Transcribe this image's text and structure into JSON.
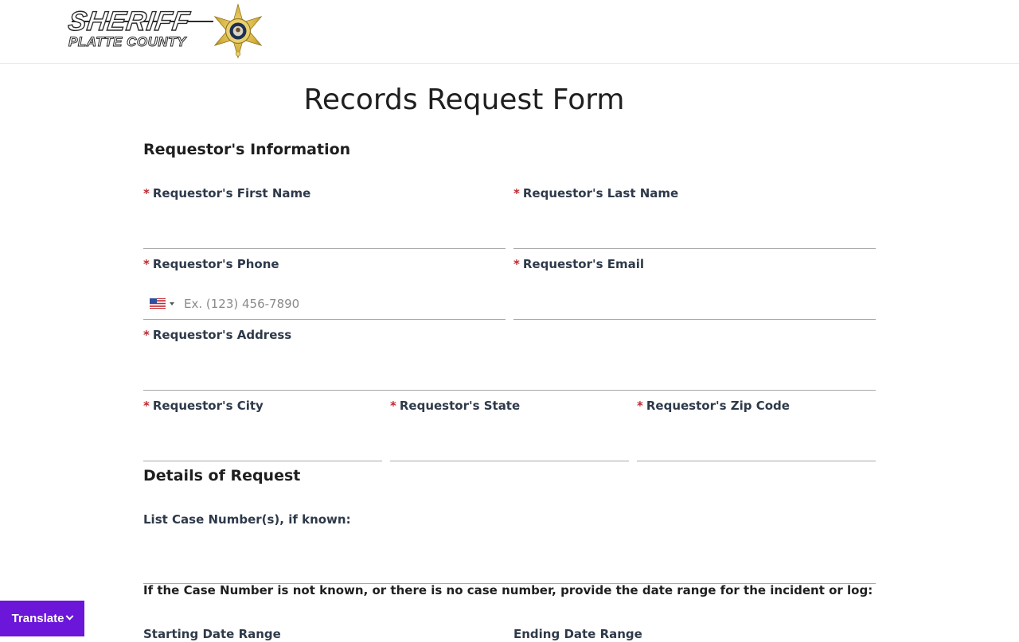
{
  "header": {
    "logo_line1": "SHERIFF",
    "logo_line2": "PLATTE COUNTY",
    "badge_text": "SHERIFF'S DEPARTMENT · PLATTE COUNTY · MO"
  },
  "form": {
    "title": "Records Request Form",
    "sections": {
      "requestor": "Requestor's Information",
      "details": "Details of Request"
    },
    "required_marker": "*",
    "fields": {
      "first_name": {
        "label": "Requestor's First Name",
        "value": ""
      },
      "last_name": {
        "label": "Requestor's Last Name",
        "value": ""
      },
      "phone": {
        "label": "Requestor's Phone",
        "placeholder": "Ex. (123) 456-7890",
        "country": "us-flag-icon"
      },
      "email": {
        "label": "Requestor's Email",
        "value": ""
      },
      "address": {
        "label": "Requestor's Address",
        "value": ""
      },
      "city": {
        "label": "Requestor's City",
        "value": ""
      },
      "state": {
        "label": "Requestor's State",
        "value": ""
      },
      "zip": {
        "label": "Requestor's Zip Code",
        "value": ""
      },
      "case_numbers": {
        "label": "List Case Number(s), if known:",
        "value": ""
      },
      "start_date": {
        "label": "Starting Date Range"
      },
      "end_date": {
        "label": "Ending Date Range"
      }
    },
    "date_range_note": "If the Case Number is not known, or there is no case number, provide the date range for the incident or log:"
  },
  "translate": {
    "label": "Translate"
  },
  "colors": {
    "required": "#c0272d",
    "translate_bg": "#6b16d9",
    "badge_gold": "#d4b13c"
  }
}
